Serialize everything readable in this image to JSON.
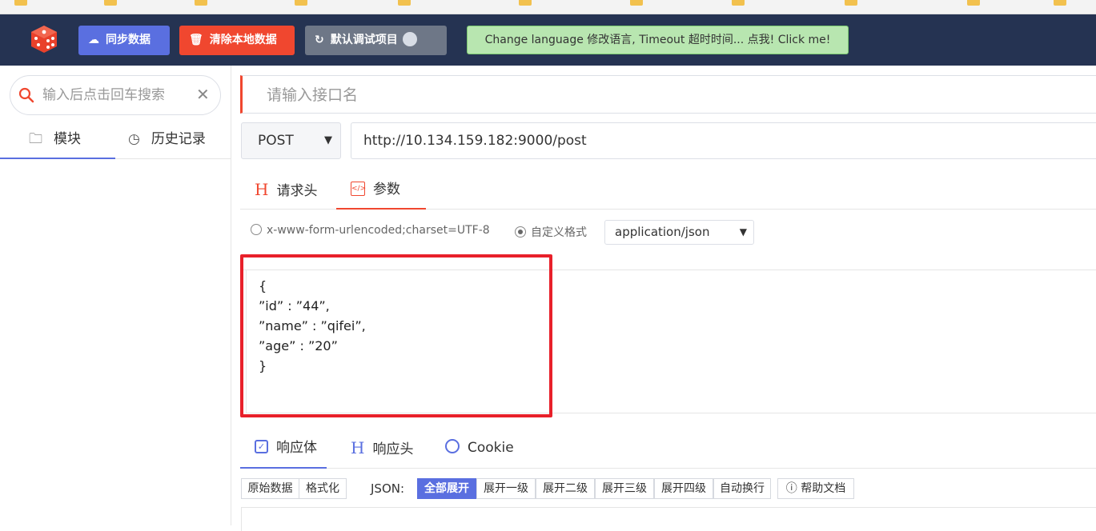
{
  "header": {
    "sync_label": "同步数据",
    "clear_label": "清除本地数据",
    "project_label": "默认调试项目",
    "language_label": "Change language 修改语言, Timeout 超时时间... 点我! Click me!"
  },
  "sidebar": {
    "search_placeholder": "输入后点击回车搜索",
    "tabs": [
      {
        "label": "模块",
        "icon": "folder-icon"
      },
      {
        "label": "历史记录",
        "icon": "clock-icon"
      }
    ]
  },
  "request": {
    "name_placeholder": "请输入接口名",
    "method": "POST",
    "url": "http://10.134.159.182:9000/post",
    "tabs": [
      {
        "label": "请求头",
        "icon": "header-icon"
      },
      {
        "label": "参数",
        "icon": "code-icon"
      }
    ],
    "content_type": {
      "option_form": "x-www-form-urlencoded;charset=UTF-8",
      "option_custom": "自定义格式",
      "selected": "application/json"
    },
    "body_lines": [
      "{",
      "”id” : ”44”,",
      "”name” : ”qifei”,",
      "”age” : ”20”",
      "}"
    ],
    "highlight_color": "#e8202a"
  },
  "response": {
    "tabs": [
      {
        "label": "响应体",
        "icon": "check-square-icon"
      },
      {
        "label": "响应头",
        "icon": "header-icon"
      },
      {
        "label": "Cookie",
        "icon": "cookie-icon"
      }
    ],
    "toolbar": {
      "raw": "原始数据",
      "format": "格式化",
      "json_label": "JSON:",
      "expand_all": "全部展开",
      "expand_1": "展开一级",
      "expand_2": "展开二级",
      "expand_3": "展开三级",
      "expand_4": "展开四级",
      "auto_wrap": "自动换行",
      "help": "帮助文档"
    }
  },
  "colors": {
    "header_bg": "#253352",
    "primary": "#5a6fe0",
    "danger": "#f0472f",
    "secondary": "#6e7787",
    "language_bg": "#b8e6b0"
  }
}
